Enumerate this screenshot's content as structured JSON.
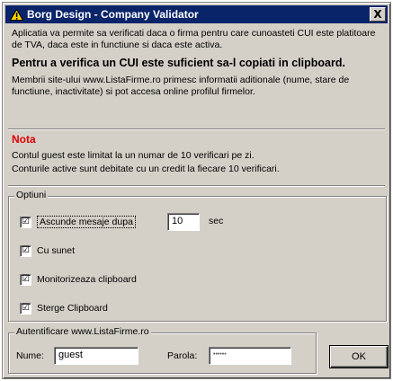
{
  "window": {
    "title": "Borg Design - Company Validator",
    "close_label": "X"
  },
  "info": {
    "paragraph1": "Aplicatia va permite sa verificati daca o firma pentru care cunoasteti CUI este platitoare de TVA, daca este in functiune si daca este activa.",
    "bold_line": "Pentru a verifica un CUI este suficient sa-l copiati in clipboard.",
    "paragraph2": "Membrii site-ului www.ListaFirme.ro primesc informatii aditionale (nume, stare de functiune, inactivitate) si pot accesa online profilul firmelor."
  },
  "nota": {
    "title": "Nota",
    "line1": "Contul guest este limitat la un numar de 10 verificari pe zi.",
    "line2": "Conturile active sunt debitate cu un credit la fiecare 10 verificari."
  },
  "options": {
    "group_label": "Optiuni",
    "hide_message": {
      "label": "Ascunde mesaje dupa",
      "checked": "☑",
      "seconds_value": "10",
      "unit": "sec"
    },
    "sound": {
      "label": "Cu sunet",
      "checked": "☑"
    },
    "monitor_clipboard": {
      "label": "Monitorizeaza clipboard",
      "checked": "☑"
    },
    "clear_clipboard": {
      "label": "Sterge Clipboard",
      "checked": "☑"
    }
  },
  "auth": {
    "group_label": "Autentificare www.ListaFirme.ro",
    "name_label": "Nume:",
    "name_value": "guest",
    "password_label": "Parola:",
    "password_value": "••••••"
  },
  "ok_label": "OK",
  "colors": {
    "titlebar": "#0a246a",
    "nota": "#e00000",
    "face": "#d4d0c8"
  }
}
